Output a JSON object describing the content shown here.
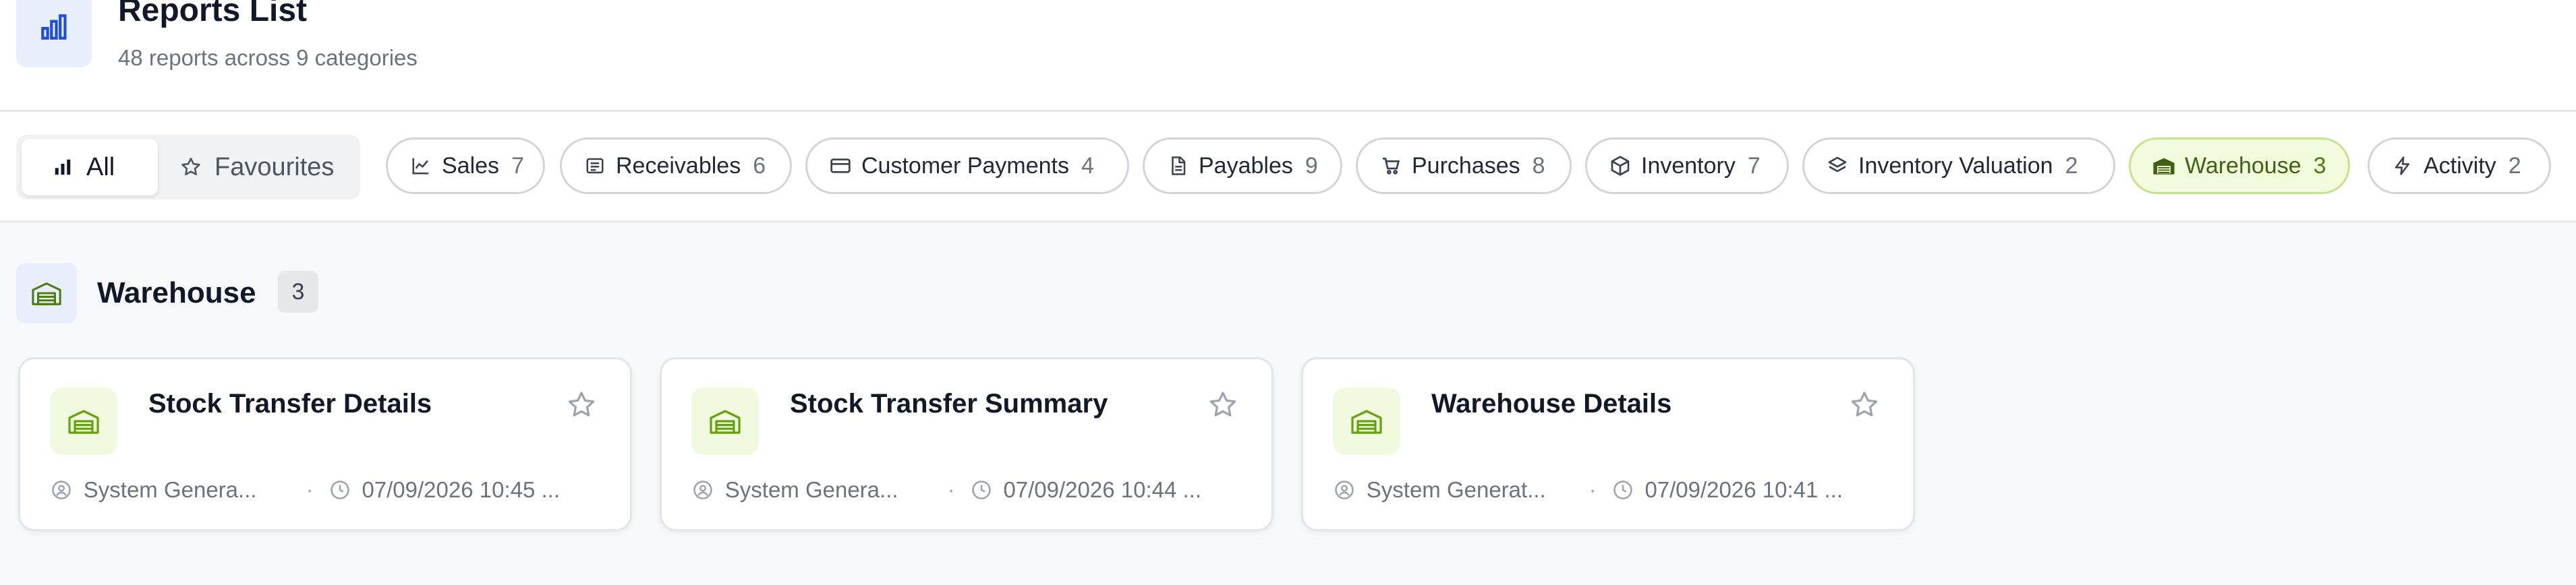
{
  "header": {
    "title": "Reports List",
    "subtitle": "48 reports across 9 categories",
    "icon": "bar-chart-icon"
  },
  "view_toggle": {
    "all_label": "All",
    "favourites_label": "Favourites",
    "selected": "All"
  },
  "categories": [
    {
      "label": "Sales",
      "count": "7",
      "icon": "line-chart-icon"
    },
    {
      "label": "Receivables",
      "count": "6",
      "icon": "receipt-icon"
    },
    {
      "label": "Customer Payments",
      "count": "4",
      "icon": "credit-card-icon"
    },
    {
      "label": "Payables",
      "count": "9",
      "icon": "document-icon"
    },
    {
      "label": "Purchases",
      "count": "8",
      "icon": "cart-icon"
    },
    {
      "label": "Inventory",
      "count": "7",
      "icon": "box-icon"
    },
    {
      "label": "Inventory Valuation",
      "count": "2",
      "icon": "layers-icon"
    },
    {
      "label": "Warehouse",
      "count": "3",
      "icon": "warehouse-icon",
      "active": true
    },
    {
      "label": "Activity",
      "count": "2",
      "icon": "lightning-icon"
    }
  ],
  "section": {
    "title": "Warehouse",
    "count": "3",
    "icon": "warehouse-icon"
  },
  "reports": [
    {
      "title": "Stock Transfer Details",
      "author": "System Genera...",
      "date": "07/09/2026 10:45 ..."
    },
    {
      "title": "Stock Transfer Summary",
      "author": "System Genera...",
      "date": "07/09/2026 10:44 ..."
    },
    {
      "title": "Warehouse Details",
      "author": "System Generat...",
      "date": "07/09/2026 10:41 ..."
    }
  ],
  "colors": {
    "accent_blue": "#2563eb",
    "accent_green": "#65a30d",
    "active_chip_bg": "#f2fbdc"
  }
}
